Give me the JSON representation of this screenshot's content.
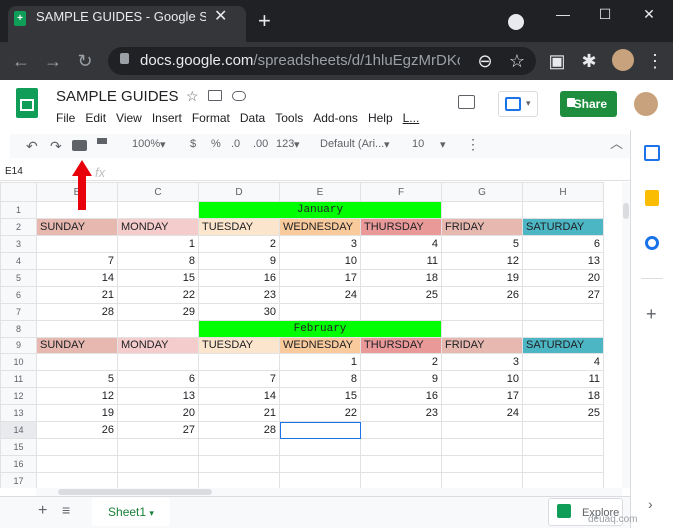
{
  "browser": {
    "tab_title": "SAMPLE GUIDES - Google Sheets",
    "tab_close": "✕",
    "new_tab": "+",
    "url_host": "docs.google.com",
    "url_path": "/spreadsheets/d/1hluEgzMrDKof...",
    "window_min": "—",
    "window_max": "☐",
    "window_close": "✕"
  },
  "sheet": {
    "title": "SAMPLE GUIDES",
    "menus": [
      "File",
      "Edit",
      "View",
      "Insert",
      "Format",
      "Data",
      "Tools",
      "Add-ons",
      "Help",
      "L..."
    ],
    "share_label": "Share"
  },
  "toolbar": {
    "zoom": "100%",
    "currency": "$",
    "percent": "%",
    "dec_decrease": ".0",
    "dec_increase": ".00",
    "format_more": "123",
    "font": "Default (Ari...",
    "font_size": "10"
  },
  "formula_bar": {
    "name_box": "E14",
    "fx": "fx"
  },
  "grid": {
    "columns": [
      "B",
      "C",
      "D",
      "E",
      "F",
      "G",
      "H"
    ],
    "selected_cell": "E14",
    "rows": [
      {
        "n": "1",
        "cells": [
          "",
          "",
          "January",
          "",
          "",
          "",
          ""
        ]
      },
      {
        "n": "2",
        "cells": [
          "SUNDAY",
          "MONDAY",
          "TUESDAY",
          "WEDNESDAY",
          "THURSDAY",
          "FRIDAY",
          "SATURDAY"
        ]
      },
      {
        "n": "3",
        "cells": [
          "",
          "1",
          "2",
          "3",
          "4",
          "5",
          "6"
        ]
      },
      {
        "n": "4",
        "cells": [
          "7",
          "8",
          "9",
          "10",
          "11",
          "12",
          "13"
        ]
      },
      {
        "n": "5",
        "cells": [
          "14",
          "15",
          "16",
          "17",
          "18",
          "19",
          "20"
        ]
      },
      {
        "n": "6",
        "cells": [
          "21",
          "22",
          "23",
          "24",
          "25",
          "26",
          "27"
        ]
      },
      {
        "n": "7",
        "cells": [
          "28",
          "29",
          "30",
          "",
          "",
          "",
          ""
        ]
      },
      {
        "n": "8",
        "cells": [
          "",
          "",
          "February",
          "",
          "",
          "",
          ""
        ]
      },
      {
        "n": "9",
        "cells": [
          "SUNDAY",
          "MONDAY",
          "TUESDAY",
          "WEDNESDAY",
          "THURSDAY",
          "FRIDAY",
          "SATURDAY"
        ]
      },
      {
        "n": "10",
        "cells": [
          "",
          "",
          "",
          "1",
          "2",
          "3",
          "4"
        ]
      },
      {
        "n": "11",
        "cells": [
          "5",
          "6",
          "7",
          "8",
          "9",
          "10",
          "11"
        ]
      },
      {
        "n": "12",
        "cells": [
          "12",
          "13",
          "14",
          "15",
          "16",
          "17",
          "18"
        ]
      },
      {
        "n": "13",
        "cells": [
          "19",
          "20",
          "21",
          "22",
          "23",
          "24",
          "25"
        ]
      },
      {
        "n": "14",
        "cells": [
          "26",
          "27",
          "28",
          "",
          "",
          "",
          ""
        ]
      },
      {
        "n": "15",
        "cells": [
          "",
          "",
          "",
          "",
          "",
          "",
          ""
        ]
      },
      {
        "n": "16",
        "cells": [
          "",
          "",
          "",
          "",
          "",
          "",
          ""
        ]
      },
      {
        "n": "17",
        "cells": [
          "",
          "",
          "",
          "",
          "",
          "",
          ""
        ]
      }
    ]
  },
  "bottom": {
    "add_sheet": "+",
    "sheet_tab": "Sheet1",
    "explore": "Explore",
    "watermark": "deuaq.com"
  },
  "colors": {
    "month_bg": "#00ff00",
    "share_bg": "#1e8e3e",
    "saturday_bg": "#4db6c4",
    "arrow": "#e8000b"
  }
}
